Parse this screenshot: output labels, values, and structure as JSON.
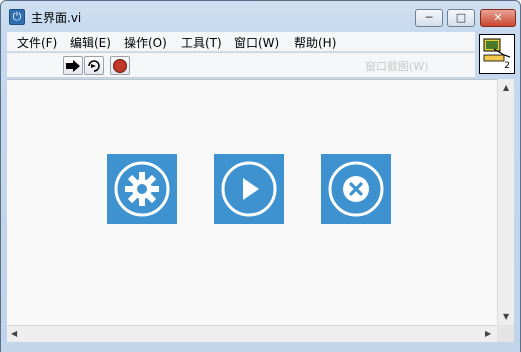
{
  "window": {
    "title": "主界面.vi",
    "controls": {
      "minimize": "─",
      "maximize": "□",
      "close": "✕"
    }
  },
  "menu": {
    "items": [
      {
        "label": "文件(F)"
      },
      {
        "label": "编辑(E)"
      },
      {
        "label": "操作(O)"
      },
      {
        "label": "工具(T)"
      },
      {
        "label": "窗口(W)"
      },
      {
        "label": "帮助(H)"
      }
    ]
  },
  "toolbar": {
    "buttons": [
      {
        "icon": "run-arrow-icon"
      },
      {
        "icon": "run-continuously-icon"
      },
      {
        "icon": "abort-execution-icon"
      }
    ],
    "palette_label": "窗口截图(W)"
  },
  "vi_icon": {
    "text": "2"
  },
  "tiles": [
    {
      "name": "settings",
      "icon": "gear-icon"
    },
    {
      "name": "run",
      "icon": "play-icon"
    },
    {
      "name": "exit",
      "icon": "close-circle-icon"
    }
  ],
  "colors": {
    "tile": "#3d92cf",
    "abort": "#c0392b"
  }
}
